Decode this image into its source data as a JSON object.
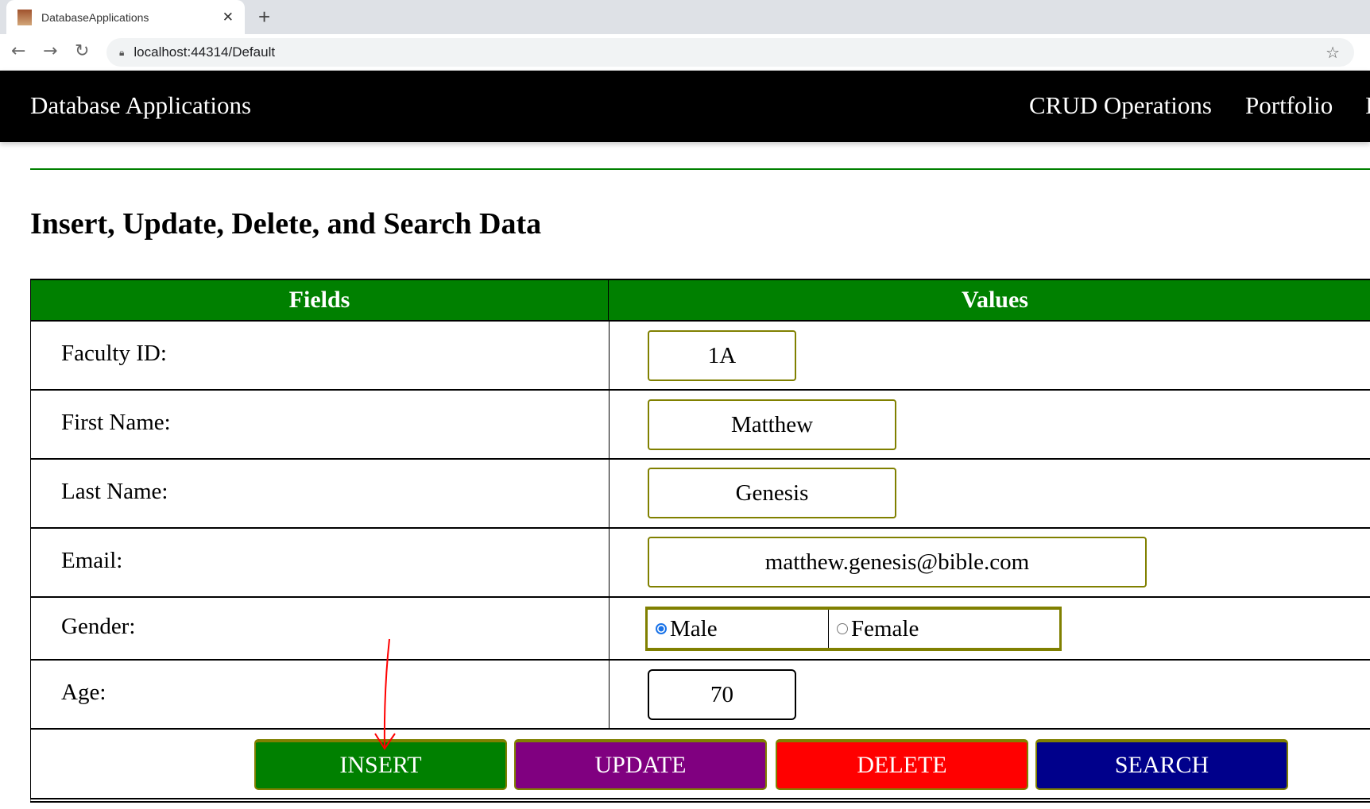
{
  "browser": {
    "tab_title": "DatabaseApplications",
    "url": "localhost:44314/Default"
  },
  "navbar": {
    "brand": "Database Applications",
    "links": [
      "CRUD Operations",
      "Portfolio",
      "I"
    ]
  },
  "page": {
    "title": "Insert, Update, Delete, and Search Data"
  },
  "table": {
    "headers": [
      "Fields",
      "Values"
    ],
    "fields": {
      "faculty_id": {
        "label": "Faculty ID:",
        "value": "1A"
      },
      "first_name": {
        "label": "First Name:",
        "value": "Matthew"
      },
      "last_name": {
        "label": "Last Name:",
        "value": "Genesis"
      },
      "email": {
        "label": "Email:",
        "value": "matthew.genesis@bible.com"
      },
      "gender": {
        "label": "Gender:",
        "options": [
          "Male",
          "Female"
        ],
        "selected": "Male"
      },
      "age": {
        "label": "Age:",
        "value": "70"
      }
    }
  },
  "buttons": {
    "insert": "INSERT",
    "update": "UPDATE",
    "delete": "DELETE",
    "search": "SEARCH"
  },
  "colors": {
    "header": "#008000",
    "insert": "#008000",
    "update": "#800080",
    "delete": "#ff0000",
    "search": "#00008b",
    "input_border": "#808000",
    "annotation_arrow": "#ff0000"
  }
}
